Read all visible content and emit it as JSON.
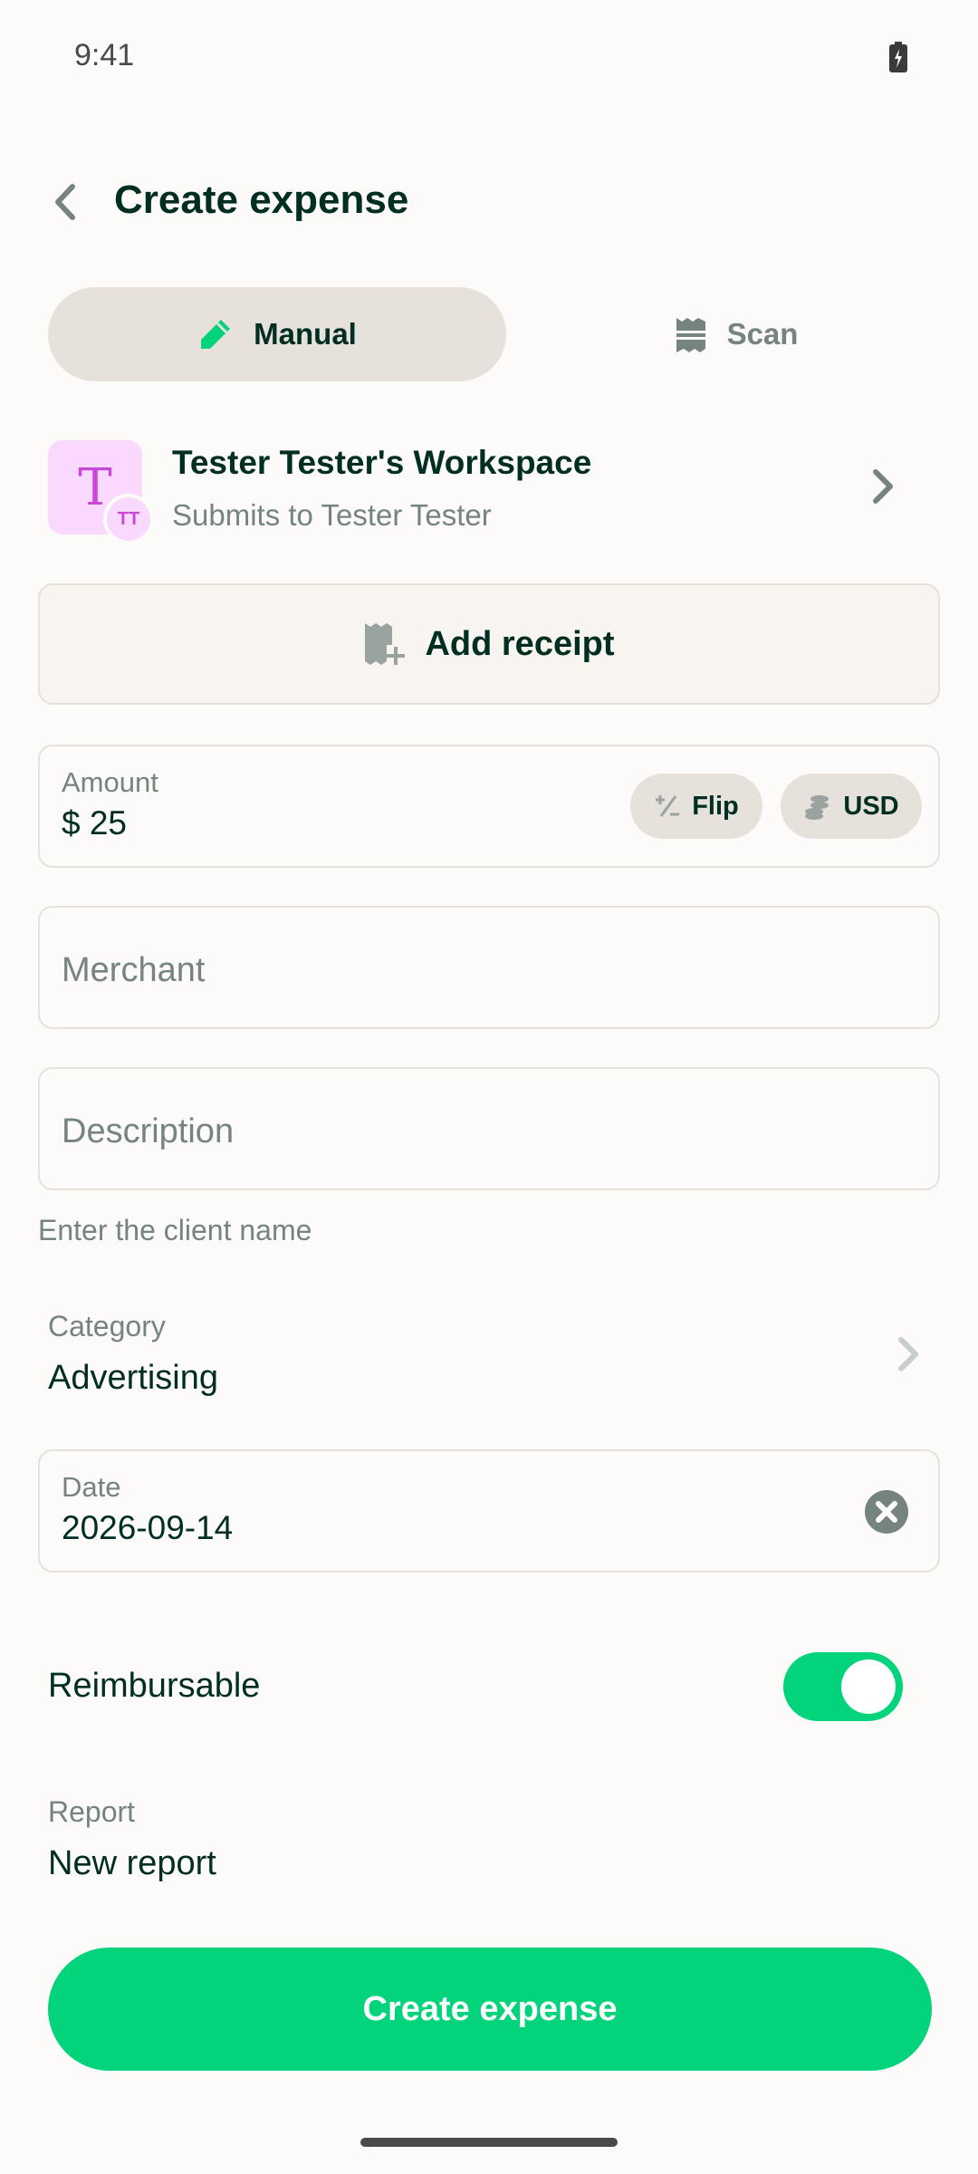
{
  "status": {
    "time": "9:41"
  },
  "header": {
    "title": "Create expense"
  },
  "tabs": [
    {
      "label": "Manual",
      "active": true,
      "icon": "pencil-icon"
    },
    {
      "label": "Scan",
      "active": false,
      "icon": "receipt-scan-icon"
    }
  ],
  "workspace": {
    "avatar_letter": "T",
    "badge_initials": "TT",
    "name": "Tester Tester's Workspace",
    "subtitle": "Submits to Tester Tester"
  },
  "receipt": {
    "label": "Add receipt"
  },
  "amount": {
    "label": "Amount",
    "currency_symbol": "$",
    "value": "25",
    "flip_label": "Flip",
    "currency_label": "USD"
  },
  "merchant": {
    "placeholder": "Merchant"
  },
  "description": {
    "placeholder": "Description",
    "hint": "Enter the client name"
  },
  "category": {
    "label": "Category",
    "value": "Advertising"
  },
  "date": {
    "label": "Date",
    "value": "2026-09-14"
  },
  "reimbursable": {
    "label": "Reimbursable",
    "enabled": true
  },
  "report": {
    "label": "Report",
    "value": "New report"
  },
  "submit": {
    "label": "Create expense"
  },
  "colors": {
    "accent": "#03D47C",
    "text": "#002E22",
    "muted": "#76847E",
    "border": "#E6E1DA",
    "avatar_bg": "#FAD9FF",
    "avatar_fg": "#C846D8"
  }
}
